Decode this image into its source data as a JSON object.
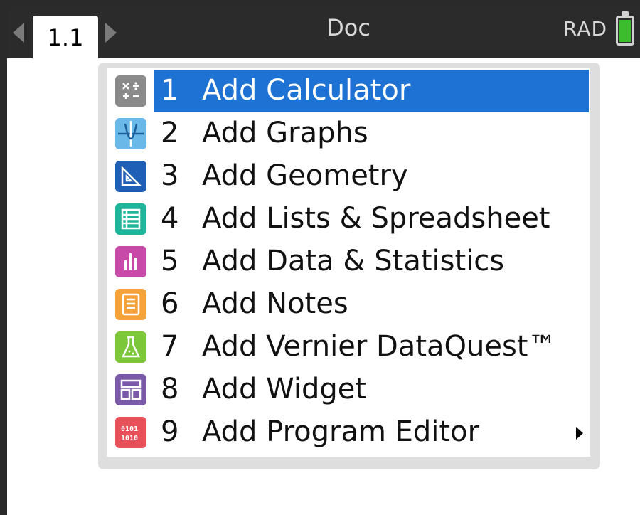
{
  "topbar": {
    "tab_label": "1.1",
    "doc_title": "Doc",
    "angle_mode": "RAD",
    "battery_color": "#3bbd2e"
  },
  "menu": {
    "selected_index": 0,
    "items": [
      {
        "number": "1",
        "label": "Add Calculator",
        "icon": "calculator-icon",
        "color": "#8a8a8a"
      },
      {
        "number": "2",
        "label": "Add Graphs",
        "icon": "graphs-icon",
        "color": "#6ab8e8"
      },
      {
        "number": "3",
        "label": "Add Geometry",
        "icon": "geometry-icon",
        "color": "#1f5fb5"
      },
      {
        "number": "4",
        "label": "Add Lists & Spreadsheet",
        "icon": "spreadsheet-icon",
        "color": "#1fb59a"
      },
      {
        "number": "5",
        "label": "Add Data & Statistics",
        "icon": "statistics-icon",
        "color": "#c84aa8"
      },
      {
        "number": "6",
        "label": "Add Notes",
        "icon": "notes-icon",
        "color": "#f5a23a"
      },
      {
        "number": "7",
        "label": "Add Vernier DataQuest™",
        "icon": "dataquest-icon",
        "color": "#7cc63a"
      },
      {
        "number": "8",
        "label": "Add Widget",
        "icon": "widget-icon",
        "color": "#7a5aa8"
      },
      {
        "number": "9",
        "label": "Add Program Editor",
        "icon": "program-editor-icon",
        "color": "#e8505a",
        "submenu": true
      }
    ]
  }
}
